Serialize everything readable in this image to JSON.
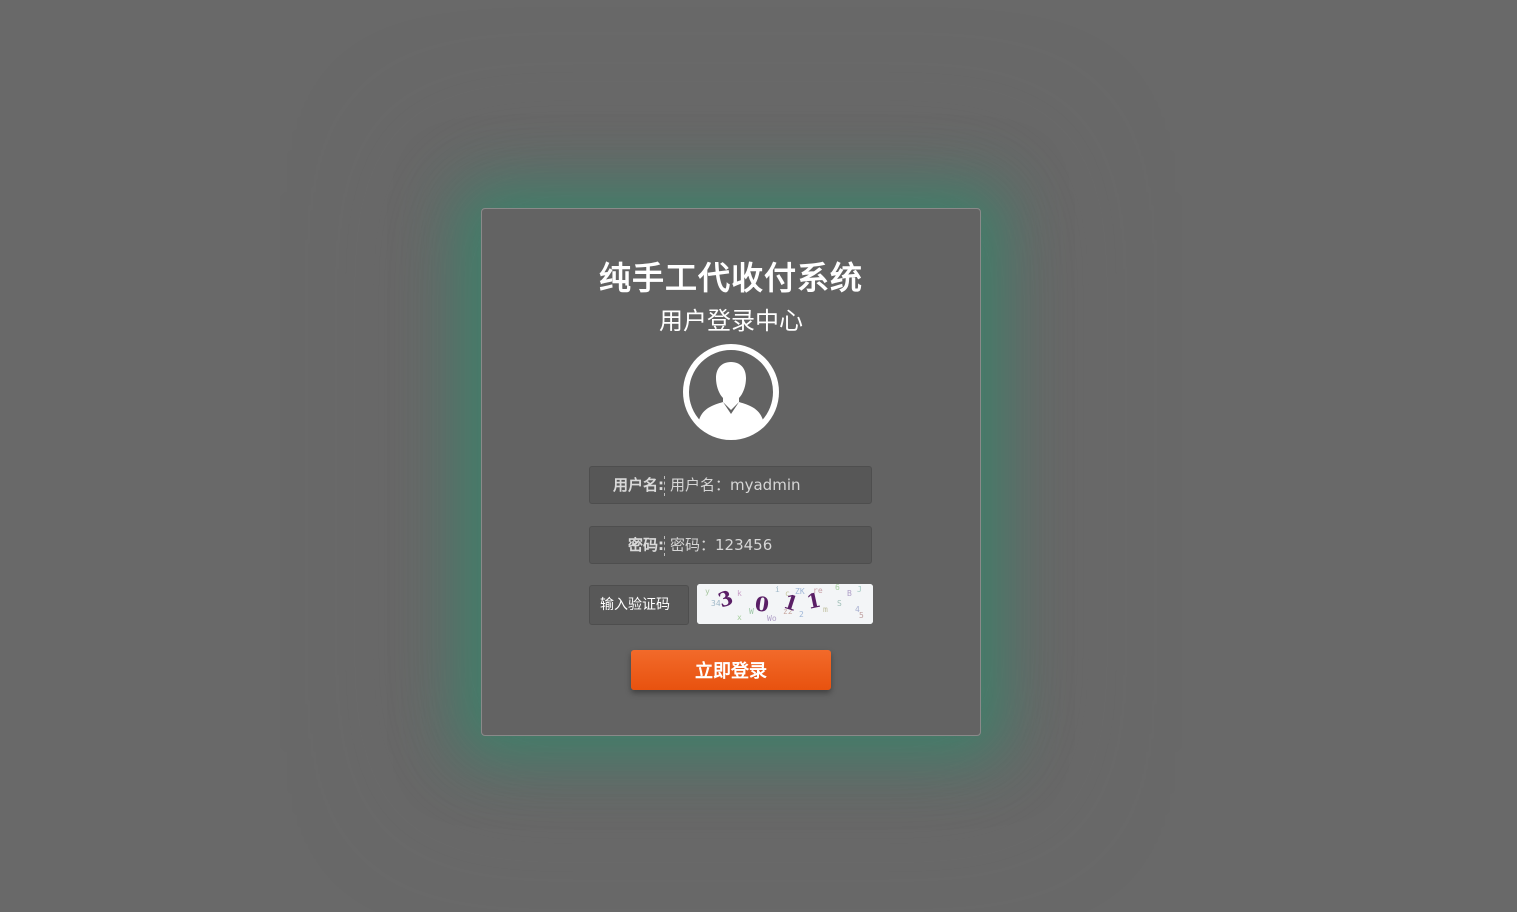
{
  "login": {
    "title": "纯手工代收付系统",
    "subtitle": "用户登录中心",
    "username": {
      "label": "用户名:",
      "placeholder": "用户名：myadmin"
    },
    "password": {
      "label": "密码:",
      "placeholder": "密码：123456"
    },
    "captcha": {
      "placeholder": "输入验证码",
      "image_text": "3 0 1 1"
    },
    "submit_label": "立即登录"
  },
  "icons": {
    "avatar": "user-avatar-icon"
  },
  "colors": {
    "background": "#696969",
    "card": "#636363",
    "glow": "#1e966e",
    "button": "#f26a2a",
    "captcha_text": "#5a1f66"
  }
}
